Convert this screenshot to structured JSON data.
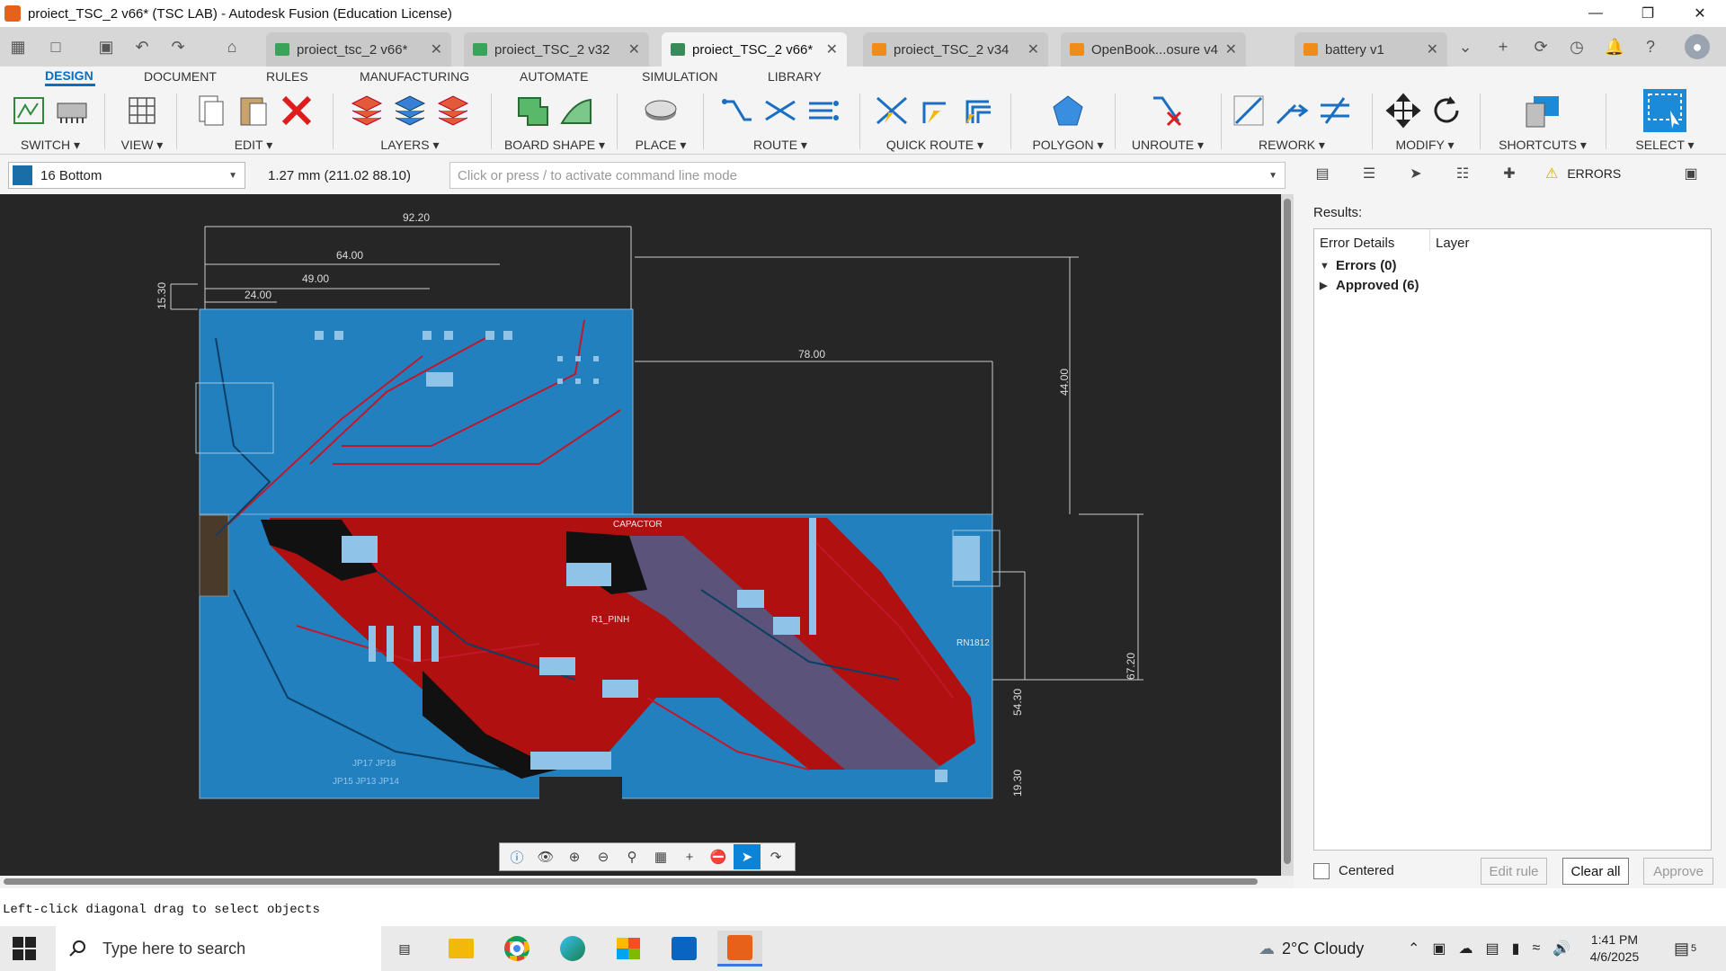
{
  "window": {
    "title": "proiect_TSC_2 v66* (TSC LAB) - Autodesk Fusion (Education License)",
    "min": "—",
    "restore": "❐",
    "close": "✕"
  },
  "tabs": [
    {
      "label": "proiect_tsc_2 v66*",
      "color": "#3aa35a"
    },
    {
      "label": "proiect_TSC_2 v32",
      "color": "#3aa35a"
    },
    {
      "label": "proiect_TSC_2 v66*",
      "color": "#3a8a5a",
      "active": true
    },
    {
      "label": "proiect_TSC_2 v34",
      "color": "#f08c1a"
    },
    {
      "label": "OpenBook...osure v4",
      "color": "#f08c1a"
    },
    {
      "label": "battery v1",
      "color": "#f08c1a"
    }
  ],
  "ribbon": {
    "tabs": [
      "DESIGN",
      "DOCUMENT",
      "RULES",
      "MANUFACTURING",
      "AUTOMATE",
      "SIMULATION",
      "LIBRARY"
    ],
    "groups": [
      "SWITCH ▾",
      "VIEW ▾",
      "EDIT ▾",
      "LAYERS ▾",
      "BOARD SHAPE ▾",
      "PLACE ▾",
      "ROUTE ▾",
      "QUICK ROUTE ▾",
      "POLYGON ▾",
      "UNROUTE ▾",
      "REWORK ▾",
      "MODIFY ▾",
      "SHORTCUTS ▾",
      "SELECT ▾"
    ]
  },
  "command": {
    "layer": "16 Bottom",
    "layer_color": "#1a6ea8",
    "coordinates": "1.27 mm (211.02 88.10)",
    "placeholder": "Click or press / to activate command line mode"
  },
  "canvas": {
    "dims": [
      "92.20",
      "64.00",
      "49.00",
      "24.00",
      "15.30",
      "44.00",
      "78.00",
      "67.20",
      "54.30",
      "19.30"
    ],
    "labels": [
      "CAPACTOR",
      "R1_PINH",
      "RN1812",
      "JP17 JP18",
      "JP15 JP13 JP14"
    ]
  },
  "panel": {
    "errors_tab": "ERRORS",
    "results_label": "Results:",
    "col_details": "Error Details",
    "col_layer": "Layer",
    "errors_row": "Errors (0)",
    "approved_row": "Approved (6)",
    "centered_label": "Centered",
    "edit_rule": "Edit rule",
    "clear_all": "Clear all",
    "approve": "Approve"
  },
  "status": {
    "message": "Left-click diagonal drag to select objects"
  },
  "taskbar": {
    "search_placeholder": "Type here to search",
    "weather": "2°C  Cloudy",
    "time": "1:41 PM",
    "date": "4/6/2025",
    "notifications": "5"
  }
}
